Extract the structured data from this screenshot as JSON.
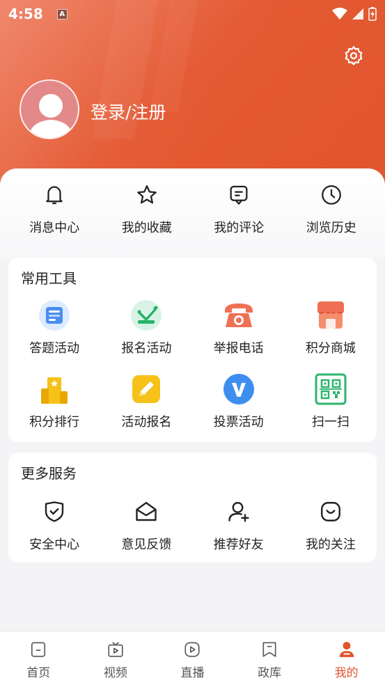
{
  "status_bar": {
    "time": "4:58",
    "notification_icon": "A"
  },
  "header": {
    "login_text": "登录/注册",
    "settings_icon": "gear-icon",
    "accent_color": "#e0552d"
  },
  "quick_actions": [
    {
      "label": "消息中心",
      "icon": "bell-icon"
    },
    {
      "label": "我的收藏",
      "icon": "star-icon"
    },
    {
      "label": "我的评论",
      "icon": "comment-icon"
    },
    {
      "label": "浏览历史",
      "icon": "clock-icon"
    }
  ],
  "tools": {
    "title": "常用工具",
    "items": [
      {
        "label": "答题活动",
        "icon": "quiz-card-icon"
      },
      {
        "label": "报名活动",
        "icon": "signup-check-icon"
      },
      {
        "label": "举报电话",
        "icon": "telephone-icon"
      },
      {
        "label": "积分商城",
        "icon": "shop-icon"
      },
      {
        "label": "积分排行",
        "icon": "ranking-podium-icon"
      },
      {
        "label": "活动报名",
        "icon": "pencil-icon"
      },
      {
        "label": "投票活动",
        "icon": "vote-v-icon"
      },
      {
        "label": "扫一扫",
        "icon": "qr-scan-icon"
      }
    ]
  },
  "services": {
    "title": "更多服务",
    "items": [
      {
        "label": "安全中心",
        "icon": "shield-check-icon"
      },
      {
        "label": "意见反馈",
        "icon": "envelope-open-icon"
      },
      {
        "label": "推荐好友",
        "icon": "add-user-icon"
      },
      {
        "label": "我的关注",
        "icon": "smile-box-icon"
      }
    ]
  },
  "bottom_nav": [
    {
      "label": "首页",
      "icon": "home-icon",
      "active": false
    },
    {
      "label": "视频",
      "icon": "tv-icon",
      "active": false
    },
    {
      "label": "直播",
      "icon": "play-icon",
      "active": false
    },
    {
      "label": "政库",
      "icon": "bookmark-icon",
      "active": false
    },
    {
      "label": "我的",
      "icon": "user-icon",
      "active": true
    }
  ]
}
